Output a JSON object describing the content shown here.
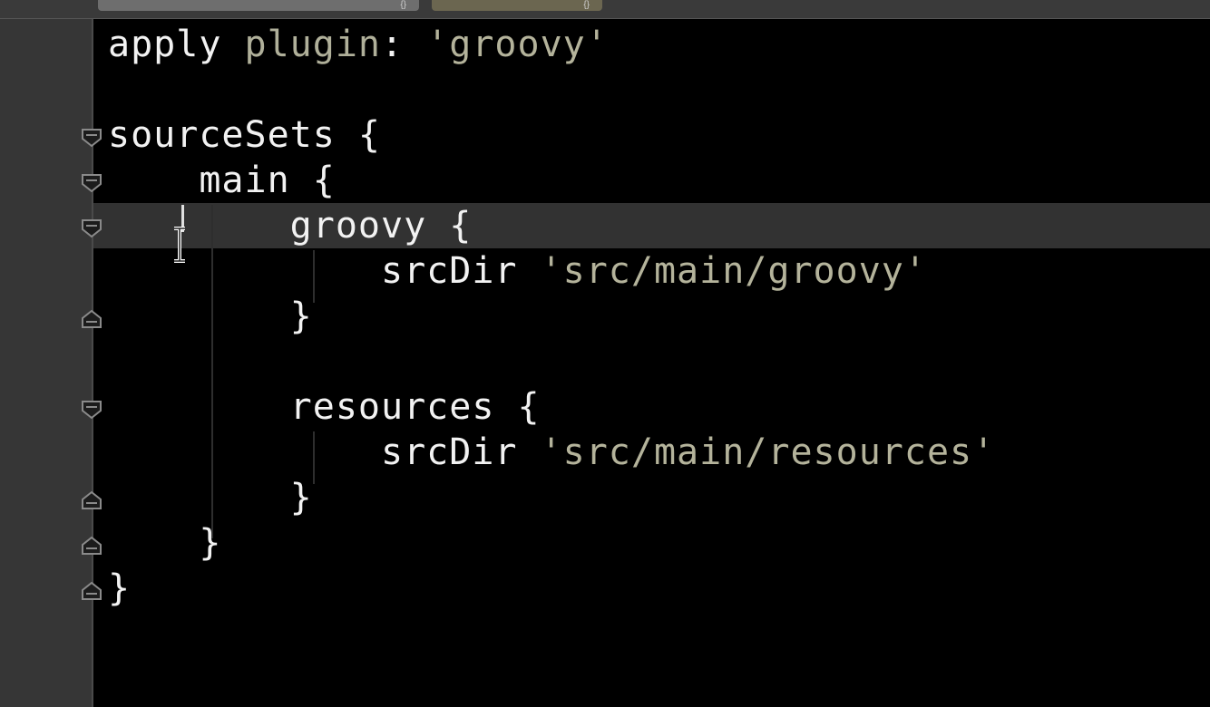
{
  "tabs": [
    {
      "label": "{}"
    },
    {
      "label": "{}"
    }
  ],
  "editor": {
    "lines": [
      {
        "indent": "",
        "parts": [
          "apply ",
          "plugin",
          ": ",
          "'groovy'"
        ]
      },
      {
        "indent": "",
        "text": ""
      },
      {
        "indent": "",
        "text": "sourceSets {"
      },
      {
        "indent": "    ",
        "text": "main {"
      },
      {
        "indent": "        ",
        "text": "groovy {"
      },
      {
        "indent": "            ",
        "parts": [
          "srcDir ",
          "'src/main/groovy'"
        ]
      },
      {
        "indent": "        ",
        "text": "}"
      },
      {
        "indent": "",
        "text": ""
      },
      {
        "indent": "        ",
        "text": "resources {"
      },
      {
        "indent": "            ",
        "parts": [
          "srcDir ",
          "'src/main/resources'"
        ]
      },
      {
        "indent": "        ",
        "text": "}"
      },
      {
        "indent": "    ",
        "text": "}"
      },
      {
        "indent": "",
        "text": "}"
      }
    ],
    "current_line_index": 4
  },
  "colors": {
    "background": "#000000",
    "gutter": "#363636",
    "current_line": "#323232",
    "text": "#f2f2f2",
    "string": "#b4b39b"
  }
}
